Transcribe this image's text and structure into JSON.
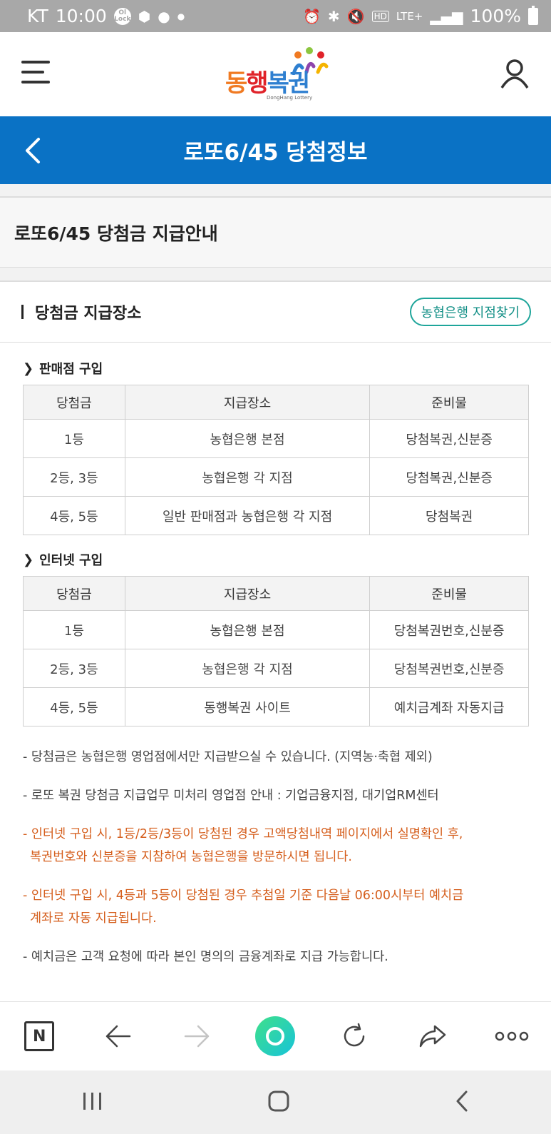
{
  "status_bar": {
    "carrier": "KT",
    "time": "10:00",
    "network": "LTE+",
    "battery": "100%"
  },
  "header": {
    "logo_parts": [
      "동",
      "행",
      "복권"
    ],
    "logo_sub": "DongHang Lottery"
  },
  "title_bar": {
    "title": "로또6/45 당첨정보"
  },
  "page_title": "로또6/45 당첨금 지급안내",
  "section": {
    "heading": "당첨금 지급장소",
    "find_branch_label": "농협은행 지점찾기"
  },
  "store_purchase": {
    "heading": "판매점 구입",
    "columns": [
      "당첨금",
      "지급장소",
      "준비물"
    ],
    "rows": [
      [
        "1등",
        "농협은행 본점",
        "당첨복권,신분증"
      ],
      [
        "2등, 3등",
        "농협은행 각 지점",
        "당첨복권,신분증"
      ],
      [
        "4등, 5등",
        "일반 판매점과 농협은행 각 지점",
        "당첨복권"
      ]
    ]
  },
  "internet_purchase": {
    "heading": "인터넷 구입",
    "columns": [
      "당첨금",
      "지급장소",
      "준비물"
    ],
    "rows": [
      [
        "1등",
        "농협은행 본점",
        "당첨복권번호,신분증"
      ],
      [
        "2등, 3등",
        "농협은행 각 지점",
        "당첨복권번호,신분증"
      ],
      [
        "4등, 5등",
        "동행복권 사이트",
        "예치금계좌 자동지급"
      ]
    ]
  },
  "notes": [
    {
      "line1": "- 당첨금은 농협은행 영업점에서만 지급받으실 수 있습니다. (지역농·축협 제외)",
      "line2": ""
    },
    {
      "line1": "- 로또 복권 당첨금 지급업무 미처리 영업점 안내 : 기업금융지점, 대기업RM센터",
      "line2": ""
    },
    {
      "line1": "- 인터넷 구입 시, 1등/2등/3등이 당첨된 경우 고액당첨내역 페이지에서 실명확인 후,",
      "line2": "복권번호와 신분증을 지참하여 농협은행을 방문하시면 됩니다."
    },
    {
      "line1": "- 인터넷 구입 시, 4등과 5등이 당첨된 경우 추첨일 기준 다음날 06:00시부터 예치금",
      "line2": "계좌로 자동 지급됩니다."
    },
    {
      "line1": "- 예치금은 고객 요청에 따라 본인 명의의 금융계좌로 지급 가능합니다.",
      "line2": ""
    }
  ],
  "colors": {
    "primary_blue": "#0a72c5",
    "accent_teal": "#1ea59a",
    "note_orange": "#d55e1c"
  },
  "browser_toolbar": {
    "icons": [
      "naver-home-icon",
      "back-arrow-icon",
      "forward-arrow-icon",
      "green-dot-icon",
      "refresh-icon",
      "share-icon",
      "more-icon"
    ],
    "home_letter": "N"
  }
}
